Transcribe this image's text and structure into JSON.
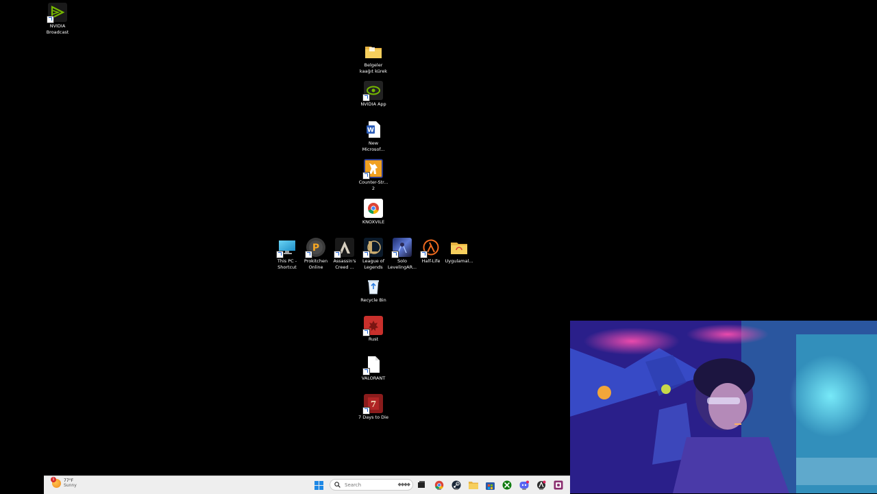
{
  "desktop": {
    "top_left_icon": {
      "label": "NVIDIA\nBroadcast",
      "icon": "nvidia-broadcast-icon"
    },
    "column_icons": [
      {
        "id": "belgeler",
        "label": "Belgeler\nkaağıt kürek",
        "icon": "folder-icon"
      },
      {
        "id": "nvidia-app",
        "label": "NVIDIA App",
        "icon": "nvidia-app-icon"
      },
      {
        "id": "new-microsoft",
        "label": "New\nMicrosof...",
        "icon": "word-document-icon"
      },
      {
        "id": "counter-strike",
        "label": "Counter-Str...\n2",
        "icon": "counter-strike-icon"
      },
      {
        "id": "knoxvile",
        "label": "KNOXVILE",
        "icon": "chrome-icon"
      },
      {
        "id": "recycle-bin",
        "label": "Recycle Bin",
        "icon": "recycle-bin-icon"
      },
      {
        "id": "rust",
        "label": "Rust",
        "icon": "rust-icon"
      },
      {
        "id": "valorant",
        "label": "VALORANT",
        "icon": "blank-file-icon"
      },
      {
        "id": "7-days",
        "label": "7 Days to Die",
        "icon": "7-days-to-die-icon"
      }
    ],
    "row_icons": [
      {
        "id": "this-pc",
        "label": "This PC -\nShortcut",
        "icon": "monitor-icon"
      },
      {
        "id": "prokitchen",
        "label": "Prokitchen\nOnline",
        "icon": "prokitchen-icon"
      },
      {
        "id": "assassins",
        "label": "Assassin's\nCreed ...",
        "icon": "assassins-creed-icon"
      },
      {
        "id": "league",
        "label": "League of\nLegends",
        "icon": "league-of-legends-icon"
      },
      {
        "id": "solo",
        "label": "Solo\nLevelingAR...",
        "icon": "solo-leveling-icon"
      },
      {
        "id": "half-life",
        "label": "Half-Life",
        "icon": "half-life-icon"
      },
      {
        "id": "uygulamal",
        "label": "Uygulamal...",
        "icon": "folder-icon"
      }
    ]
  },
  "taskbar": {
    "weather": {
      "temp": "77°F",
      "condition": "Sunny",
      "badge": "1"
    },
    "search_placeholder": "Search",
    "apps": [
      "start-icon",
      "task-view-icon",
      "chrome-icon",
      "steam-icon",
      "file-explorer-icon",
      "store-icon",
      "xbox-icon",
      "discord-icon",
      "app-icon",
      "media-app-icon"
    ]
  },
  "colors": {
    "taskbar_bg": "#eeeeee",
    "desktop_bg": "#000000",
    "nvidia_green": "#76b900"
  }
}
